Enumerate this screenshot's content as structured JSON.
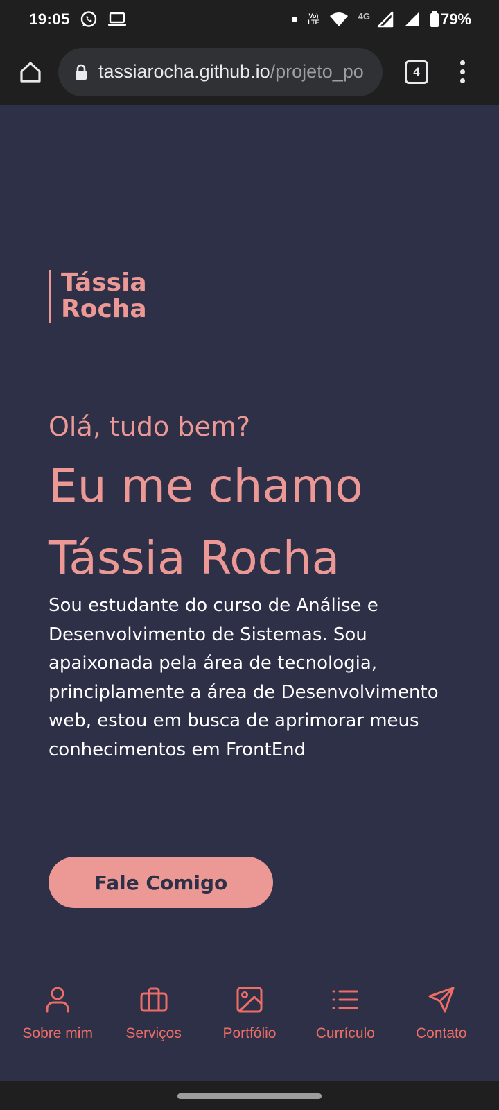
{
  "status_bar": {
    "time": "19:05",
    "network_small": "4G",
    "volte_top": "Vo)",
    "volte_bottom": "LTE",
    "battery": "79%",
    "icons": [
      "whatsapp-icon",
      "laptop-icon",
      "dot-icon",
      "volte-icon",
      "wifi-icon",
      "signal-icon",
      "signal-icon",
      "battery-icon"
    ]
  },
  "browser": {
    "url_host": "tassiarocha.github.io",
    "url_path": "/projeto_po",
    "tab_count": "4",
    "icons": [
      "home-icon",
      "lock-icon",
      "tabs-icon",
      "more-vert-icon"
    ]
  },
  "hero": {
    "logo_line1": "Tássia",
    "logo_line2": "Rocha",
    "greeting": "Olá, tudo bem?",
    "headline_line1": "Eu me chamo",
    "headline_line2": "Tássia Rocha",
    "intro": "Sou estudante do curso de Análise e Desenvolvimento de Sistemas. Sou apaixonada pela área de tecnologia, principlamente a área de Desenvolvimento web, estou em busca de aprimorar meus conhecimentos em FrontEnd",
    "cta_label": "Fale Comigo"
  },
  "nav": {
    "items": [
      {
        "label": "Sobre mim",
        "icon": "user-icon"
      },
      {
        "label": "Serviços",
        "icon": "briefcase-icon"
      },
      {
        "label": "Portfólio",
        "icon": "image-icon"
      },
      {
        "label": "Currículo",
        "icon": "list-icon"
      },
      {
        "label": "Contato",
        "icon": "send-icon"
      }
    ]
  },
  "colors": {
    "background": "#2e3048",
    "accent": "#ec9996",
    "nav_accent": "#ec6e66",
    "text": "#ffffff",
    "chrome": "#1f1f1f"
  }
}
